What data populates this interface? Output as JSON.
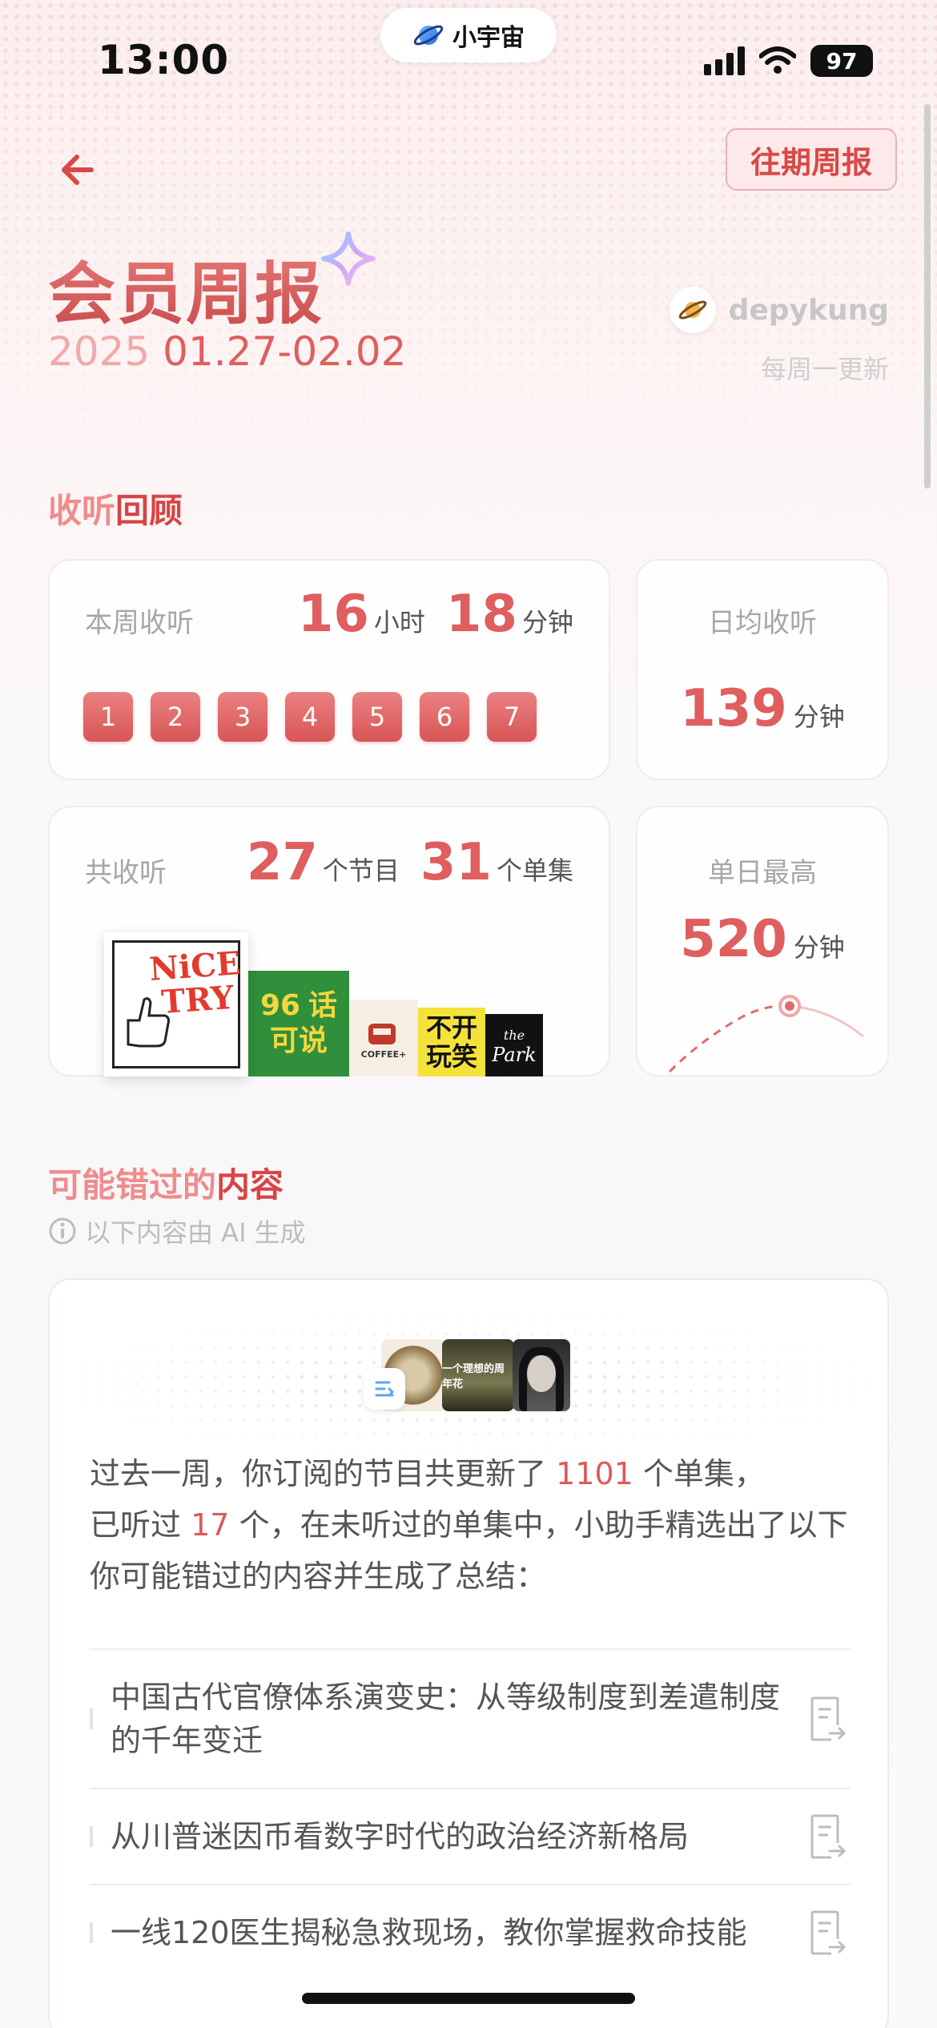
{
  "status_bar": {
    "time": "13:00",
    "mini_app_name": "小宇宙",
    "battery": "97"
  },
  "header": {
    "history_button": "往期周报",
    "title": "会员周报",
    "date_year": "2025",
    "date_range": "01.27-02.02",
    "username": "depykung",
    "update_note": "每周一更新"
  },
  "listen_review": {
    "title_a": "收听",
    "title_b": "回顾",
    "weekly": {
      "label": "本周收听",
      "hours": "16",
      "hours_unit": "小时",
      "minutes": "18",
      "minutes_unit": "分钟",
      "days": [
        "1",
        "2",
        "3",
        "4",
        "5",
        "6",
        "7"
      ]
    },
    "daily_avg": {
      "label": "日均收听",
      "value": "139",
      "unit": "分钟"
    },
    "total": {
      "label": "共收听",
      "shows": "27",
      "shows_unit": "个节目",
      "episodes": "31",
      "episodes_unit": "个单集"
    },
    "daily_max": {
      "label": "单日最高",
      "value": "520",
      "unit": "分钟"
    },
    "covers": [
      {
        "name": "nice-try-cover",
        "text_1": "NiCE",
        "text_2": "TRY"
      },
      {
        "name": "hua-ke-shuo-cover",
        "text_1": "话",
        "text_2": "可说"
      },
      {
        "name": "coffee-cover",
        "text_1": "COFFEE+"
      },
      {
        "name": "bu-kai-wan-xiao-cover",
        "text_1": "不开",
        "text_2": "玩笑"
      },
      {
        "name": "the-park-cover",
        "text_1": "the",
        "text_2": "Park"
      }
    ]
  },
  "missed": {
    "title_a": "可能错过的",
    "title_b": "内容",
    "ai_note": "以下内容由 AI 生成",
    "summary_1": "过去一周，你订阅的节目共更新了",
    "updated_count": "1101",
    "summary_2": "个单集，",
    "summary_3": "已听过",
    "heard_count": "17",
    "summary_4": "个，在未听过的单集中，小助手精选出了以下你可能错过的内容并生成了总结：",
    "items": [
      "中国古代官僚体系演变史：从等级制度到差遣制度的千年变迁",
      "从川普迷因币看数字时代的政治经济新格局",
      "一线120医生揭秘急救现场，教你掌握救命技能"
    ],
    "cover_text": "一个理想的周年花"
  },
  "colors": {
    "accent": "#d94848",
    "accent_light": "#ef8c8c",
    "number": "#df5e5e"
  }
}
